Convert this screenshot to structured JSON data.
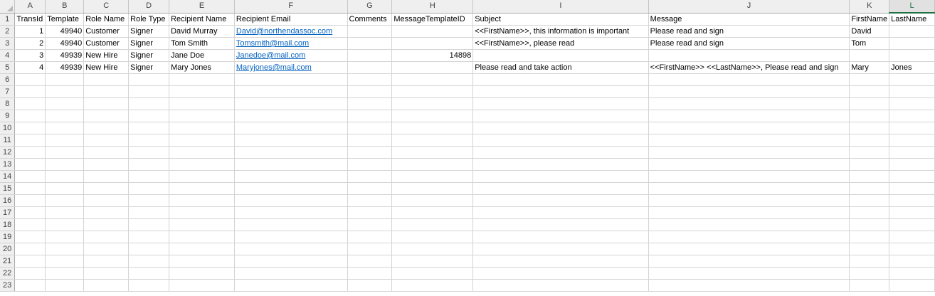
{
  "columns": [
    "A",
    "B",
    "C",
    "D",
    "E",
    "F",
    "G",
    "H",
    "I",
    "J",
    "K",
    "L"
  ],
  "row_numbers": [
    "1",
    "2",
    "3",
    "4",
    "5",
    "6",
    "7",
    "8",
    "9",
    "10",
    "11",
    "12",
    "13",
    "14",
    "15",
    "16",
    "17",
    "18",
    "19",
    "20",
    "21",
    "22",
    "23"
  ],
  "headers": [
    "TransId",
    "Template",
    "Role Name",
    "Role Type",
    "Recipient Name",
    "Recipient Email",
    "Comments",
    "MessageTemplateID",
    "Subject",
    "Message",
    "FirstName",
    "LastName"
  ],
  "rows": [
    {
      "transid": "1",
      "template": "49940",
      "role_name": "Customer",
      "role_type": "Signer",
      "recipient_name": "David Murray",
      "recipient_email": "David@northendassoc.com",
      "comments": "",
      "message_template_id": "",
      "subject": "<<FirstName>>, this information is important",
      "message": "Please read and sign",
      "first_name": "David",
      "last_name": ""
    },
    {
      "transid": "2",
      "template": "49940",
      "role_name": "Customer",
      "role_type": "Signer",
      "recipient_name": "Tom Smith",
      "recipient_email": "Tomsmith@mail.com",
      "comments": "",
      "message_template_id": "",
      "subject": "<<FirstName>>, please read",
      "message": "Please read and sign",
      "first_name": "Tom",
      "last_name": ""
    },
    {
      "transid": "3",
      "template": "49939",
      "role_name": "New Hire",
      "role_type": "Signer",
      "recipient_name": "Jane Doe",
      "recipient_email": "Janedoe@mail.com",
      "comments": "",
      "message_template_id": "14898",
      "subject": "",
      "message": "",
      "first_name": "",
      "last_name": ""
    },
    {
      "transid": "4",
      "template": "49939",
      "role_name": "New Hire",
      "role_type": "Signer",
      "recipient_name": "Mary Jones",
      "recipient_email": "Maryjones@mail.com",
      "comments": "",
      "message_template_id": "",
      "subject": "Please read and take action",
      "message": "<<FirstName>> <<LastName>>, Please read and sign",
      "first_name": "Mary",
      "last_name": "Jones"
    }
  ],
  "colors": {
    "accent": "#217346",
    "link": "#0563c1",
    "header_bg": "#efefef",
    "gridline": "#d4d4d4"
  }
}
